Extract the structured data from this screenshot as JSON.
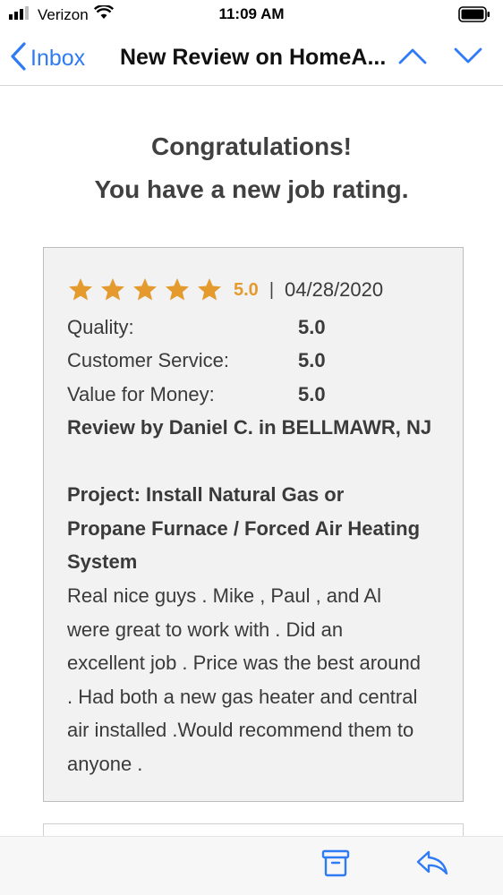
{
  "status_bar": {
    "carrier": "Verizon",
    "time": "11:09 AM",
    "icons": [
      "signal-bars-icon",
      "wifi-icon",
      "battery-icon"
    ]
  },
  "nav": {
    "back_label": "Inbox",
    "title": "New Review on HomeA...",
    "icons": [
      "chevron-left-icon",
      "chevron-up-icon",
      "chevron-down-icon"
    ],
    "accent_color": "#2f7bf5"
  },
  "email": {
    "headline_line1": "Congratulations!",
    "headline_line2": "You have a new job rating.",
    "review": {
      "stars": 5,
      "star_color": "#e59a2d",
      "rating": "5.0",
      "separator": "|",
      "date": "04/28/2020",
      "metrics": [
        {
          "label": "Quality:",
          "value": "5.0"
        },
        {
          "label": "Customer Service:",
          "value": "5.0"
        },
        {
          "label": "Value for Money:",
          "value": "5.0"
        }
      ],
      "reviewer": "Review by Daniel C. in BELLMAWR, NJ",
      "project": "Project: Install Natural Gas or Propane Furnace / Forced Air Heating System",
      "text": "Real nice guys . Mike , Paul , and Al were great to work with . Did an excellent job . Price was the best around . Had both a new gas heater and central air installed .Would recommend them to anyone ."
    }
  },
  "toolbar": {
    "icons": [
      "archive-icon",
      "reply-icon"
    ]
  }
}
